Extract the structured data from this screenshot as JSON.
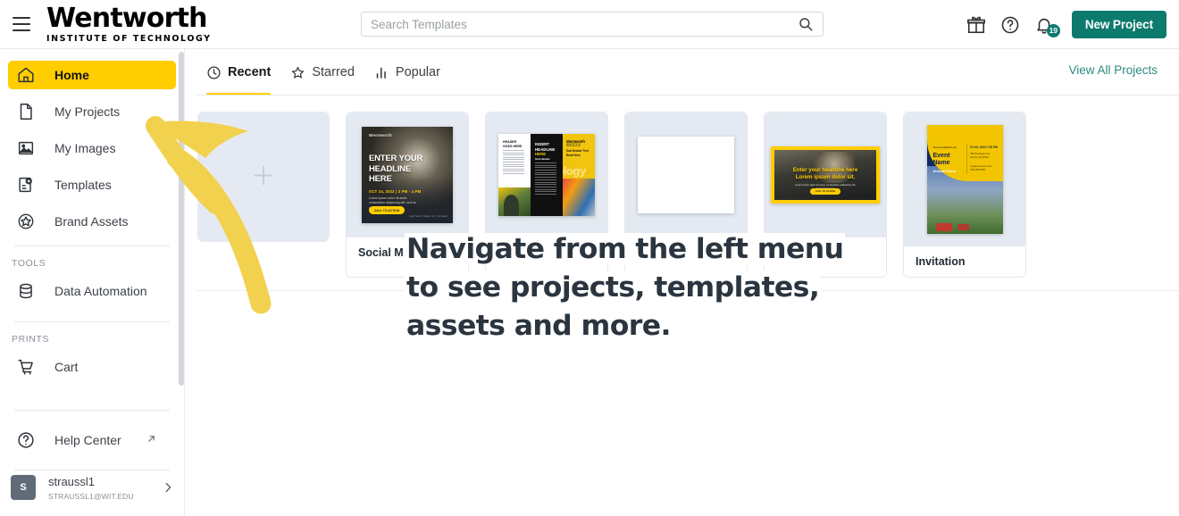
{
  "header": {
    "menu_icon": "hamburger-icon",
    "brand_name": "Wentworth",
    "brand_subtitle": "INSTITUTE OF TECHNOLOGY",
    "search_placeholder": "Search Templates",
    "search_value": "",
    "search_icon": "search-icon",
    "gift_icon": "gift-icon",
    "help_icon": "question-circle-icon",
    "bell_icon": "bell-icon",
    "notification_count": "19",
    "new_project_label": "New Project",
    "accent_teal": "#0d7a6e",
    "accent_yellow": "#ffcd00"
  },
  "sidebar": {
    "items": [
      {
        "label": "Home",
        "icon": "home-icon",
        "active": true
      },
      {
        "label": "My Projects",
        "icon": "document-icon",
        "active": false
      },
      {
        "label": "My Images",
        "icon": "image-icon",
        "active": false
      },
      {
        "label": "Templates",
        "icon": "template-star-icon",
        "active": false
      },
      {
        "label": "Brand Assets",
        "icon": "brand-shield-icon",
        "active": false
      }
    ],
    "tools_section_label": "TOOLS",
    "tools_items": [
      {
        "label": "Data Automation",
        "icon": "database-icon"
      }
    ],
    "prints_section_label": "PRINTS",
    "prints_items": [
      {
        "label": "Cart",
        "icon": "cart-icon"
      }
    ],
    "help": {
      "label": "Help Center",
      "icon": "question-circle-icon",
      "external_icon": "external-link-icon"
    },
    "account": {
      "avatar_initial": "S",
      "name": "straussl1",
      "email": "STRAUSSL1@WIT.EDU",
      "chevron_icon": "chevron-right-icon"
    }
  },
  "main": {
    "tabs": [
      {
        "label": "Recent",
        "icon": "clock-icon",
        "active": true
      },
      {
        "label": "Starred",
        "icon": "star-icon",
        "active": false
      },
      {
        "label": "Popular",
        "icon": "bar-chart-icon",
        "active": false
      }
    ],
    "view_all_label": "View All Projects",
    "cards": [
      {
        "type": "placeholder",
        "label": "",
        "icon": "plus-icon"
      },
      {
        "type": "social",
        "label": "Social M",
        "art": {
          "brand": "Wentworth",
          "headline": "ENTER YOUR\nHEADLINE\nHERE",
          "meta": "OCT 24, 2022  |  3 PM - 4 PM",
          "body": "Lorem ipsum dolor sit amet, consectetur adipiscing elit, sed do eiusmod.",
          "cta": "CALL TO ACTION",
          "footer": "Call Now  |  About Us  |  Contact"
        }
      },
      {
        "type": "brochure",
        "label": "",
        "art": {
          "p1_heading": "HEADER GOES HERE",
          "p2_heading": "INSERT HEADLINE HERE",
          "p2_sub": "Sub Header",
          "p3_brand": "Wentworth",
          "p3_brand_sub": "INSTITUTE OF TECHNOLOGY",
          "p3_heading": "Sub Header Text\nRead Here",
          "p3_ghost": "nology"
        }
      },
      {
        "type": "blank",
        "label": ""
      },
      {
        "type": "banner",
        "label": "",
        "art": {
          "headline": "Enter your headline here\nLorem ipsum dolor sit.",
          "sub": "Lorem ipsum dolor sit amet, consectetur adipiscing elit,\nsed do eiusmod.",
          "cta": "CALL TO ACTION"
        }
      },
      {
        "type": "invitation",
        "label": "Invitation",
        "art": {
          "overline": "You are invited to our",
          "name": "Event\nName",
          "annual": "Annual Event",
          "date": "Fri 22, 2022 7:00 PM",
          "address": "550 Huntington Ave\nBoston, MA 02115",
          "rsvp": "rsvp@eventname.com\n(555) 555-5555"
        }
      }
    ]
  },
  "coachmark": {
    "lines": [
      "Navigate from the left menu",
      "to see projects, templates,",
      "assets and more."
    ],
    "arrow_color": "#f2d14e",
    "arrow_icon": "curved-arrow-up-left-icon"
  }
}
